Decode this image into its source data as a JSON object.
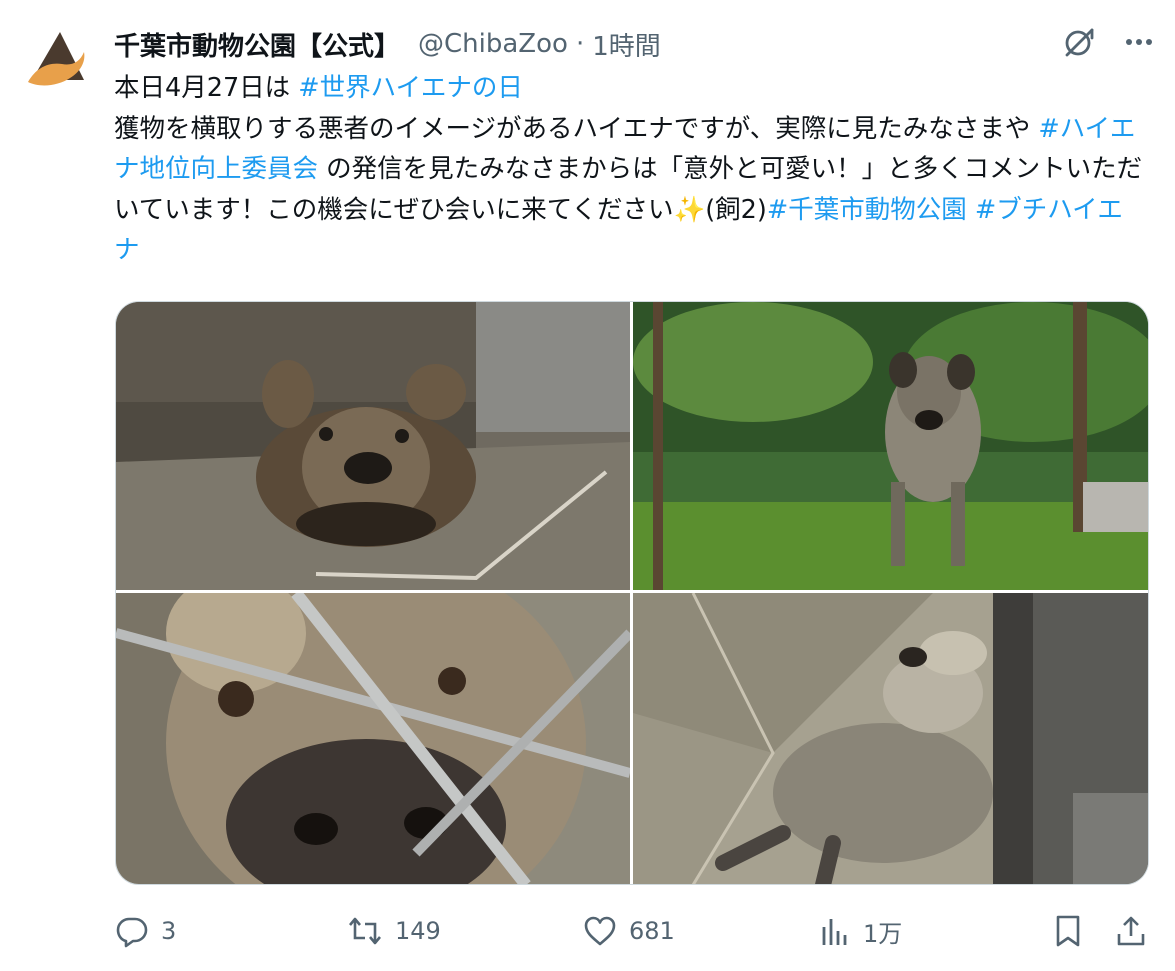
{
  "post": {
    "display_name": "千葉市動物公園【公式】",
    "handle": "@ChibaZoo",
    "separator": "·",
    "time": "1時間",
    "text_segments": [
      {
        "text": "本日4月27日は ",
        "hashtag": false
      },
      {
        "text": "#世界ハイエナの日",
        "hashtag": true
      },
      {
        "text": "\n獲物を横取りする悪者のイメージがあるハイエナですが、実際に見たみなさまや ",
        "hashtag": false
      },
      {
        "text": "#ハイエナ地位向上委員会",
        "hashtag": true
      },
      {
        "text": " の発信を見たみなさまからは「意外と可愛い！」と多くコメントいただいています！この機会にぜひ会いに来てください✨(飼2)",
        "hashtag": false
      },
      {
        "text": "#千葉市動物公園",
        "hashtag": true
      },
      {
        "text": " ",
        "hashtag": false
      },
      {
        "text": "#ブチハイエナ",
        "hashtag": true
      }
    ],
    "images": [
      {
        "name": "hyena-resting-indoors"
      },
      {
        "name": "hyena-standing-outdoors"
      },
      {
        "name": "hyena-nose-through-fence"
      },
      {
        "name": "hyena-lying-on-back"
      }
    ]
  },
  "actions": {
    "replies": "3",
    "reposts": "149",
    "likes": "681",
    "views": "1万"
  },
  "icons": {
    "avatar": "chiba-zoo-logo",
    "grok": "grok-icon",
    "more": "more-icon",
    "reply": "reply-icon",
    "repost": "repost-icon",
    "like": "like-icon",
    "views": "views-icon",
    "bookmark": "bookmark-icon",
    "share": "share-icon"
  },
  "colors": {
    "text": "#0f1419",
    "secondary": "#536471",
    "hashtag": "#1d9bf0",
    "border": "#cfd9de",
    "logo_orange": "#e8a04a"
  }
}
